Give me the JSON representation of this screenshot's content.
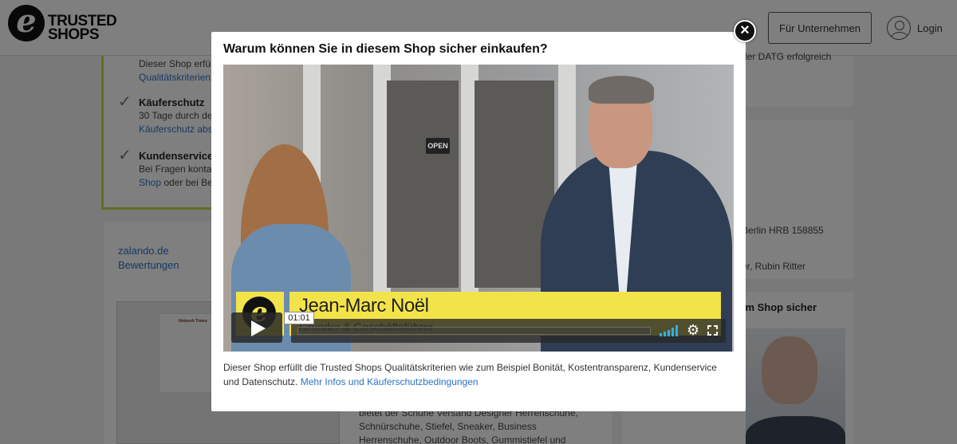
{
  "header": {
    "logo_line1": "TRUSTED",
    "logo_line2": "SHOPS",
    "logo_letter": "e",
    "business_button": "Für Unternehmen",
    "login_label": "Login"
  },
  "background": {
    "feature_intro_text": "Dieser Shop erfüllt",
    "feature_intro_link": "Qualitätskriterien",
    "features": [
      {
        "title": "Käuferschutz",
        "line1": "30 Tage durch de",
        "line2": "Käuferschutz abs"
      },
      {
        "title": "Kundenservice",
        "line1": "Bei Fragen kontakt",
        "line2_link": "Shop",
        "line2_rest": " oder bei Be"
      }
    ],
    "shop_logo_alt": "zalando.de",
    "reviews_link": "Bewertungen",
    "shot_title": "Network Timeo",
    "below_text": [
      "bietet der Schuhe Versand Designer Herrenschuhe,",
      "Schnürschuhe, Stiefel, Sneaker, Business",
      "Herrenschuhe, Outdoor Boots, Gummistiefel und"
    ],
    "right_snippet_top": "der DATG erfolgreich",
    "right_register": "Berlin HRB 158855",
    "right_names": "er, Rubin Ritter",
    "right_heading": "sem Shop sicher"
  },
  "modal": {
    "title": "Warum können Sie in diesem Shop sicher einkaufen?",
    "close_symbol": "×",
    "video": {
      "sign_text": "OPEN",
      "name": "Jean-Marc Noël",
      "role": "Gründer & Geschäftsführer",
      "time_tooltip": "01:01",
      "progress": 0.0,
      "volume_level": 1.0
    },
    "description": "Dieser Shop erfüllt die Trusted Shops Qualitätskriterien wie zum Beispiel Bonität, Kostentransparenz, Kundenservice und Datenschutz.",
    "description_link": "Mehr Infos und Käuferschutzbedingungen"
  },
  "colors": {
    "accent_green": "#c8d64e",
    "link_blue": "#2b72c7",
    "lower_third_yellow": "#f3e34b",
    "volume_blue": "#28b2e8"
  },
  "icons": [
    "trusted-shops-logo-icon",
    "user-icon",
    "close-icon",
    "checkmark-icon",
    "play-icon",
    "volume-icon",
    "gear-icon",
    "fullscreen-icon"
  ]
}
